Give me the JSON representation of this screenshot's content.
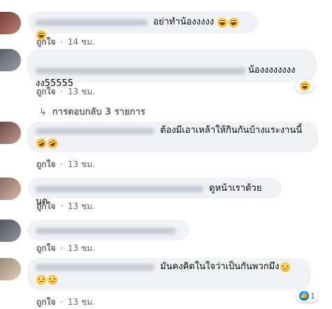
{
  "ui": {
    "like_label": "ถูกใจ",
    "separator": "·"
  },
  "comments": [
    {
      "text": "อย่าทำน้องงงงง",
      "emoji": [
        "laugh",
        "laugh",
        "laugh"
      ],
      "time": "14 ชม."
    },
    {
      "text": "น้องงงงงงงง\nงง55555",
      "time": "13 ชม.",
      "reaction": {
        "type": "laugh"
      }
    },
    {
      "text": "ต้องมีเอาเหล้าให้กินกันบ้างแระงานนี้",
      "emoji": [
        "laugh-tilt",
        "laugh-tilt"
      ],
      "time": "13 ชม."
    },
    {
      "text": "ดูหน้าเราด้วยนุด",
      "time": "13 ชม."
    },
    {
      "text": "",
      "time": "13 ชม."
    },
    {
      "text": "มันคงคิดในใจว่าเป็นกันพวกมึง",
      "emoji": [
        "sad",
        "sad",
        "sad"
      ],
      "time": "13 ชม.",
      "reaction": {
        "type": "like",
        "count": "1"
      }
    }
  ],
  "replies_link": "การตอบกลับ 3 รายการ",
  "colors": {
    "bubble": "#f0f2f5",
    "meta_text": "#65676b",
    "like_blue": "#1877f2"
  }
}
